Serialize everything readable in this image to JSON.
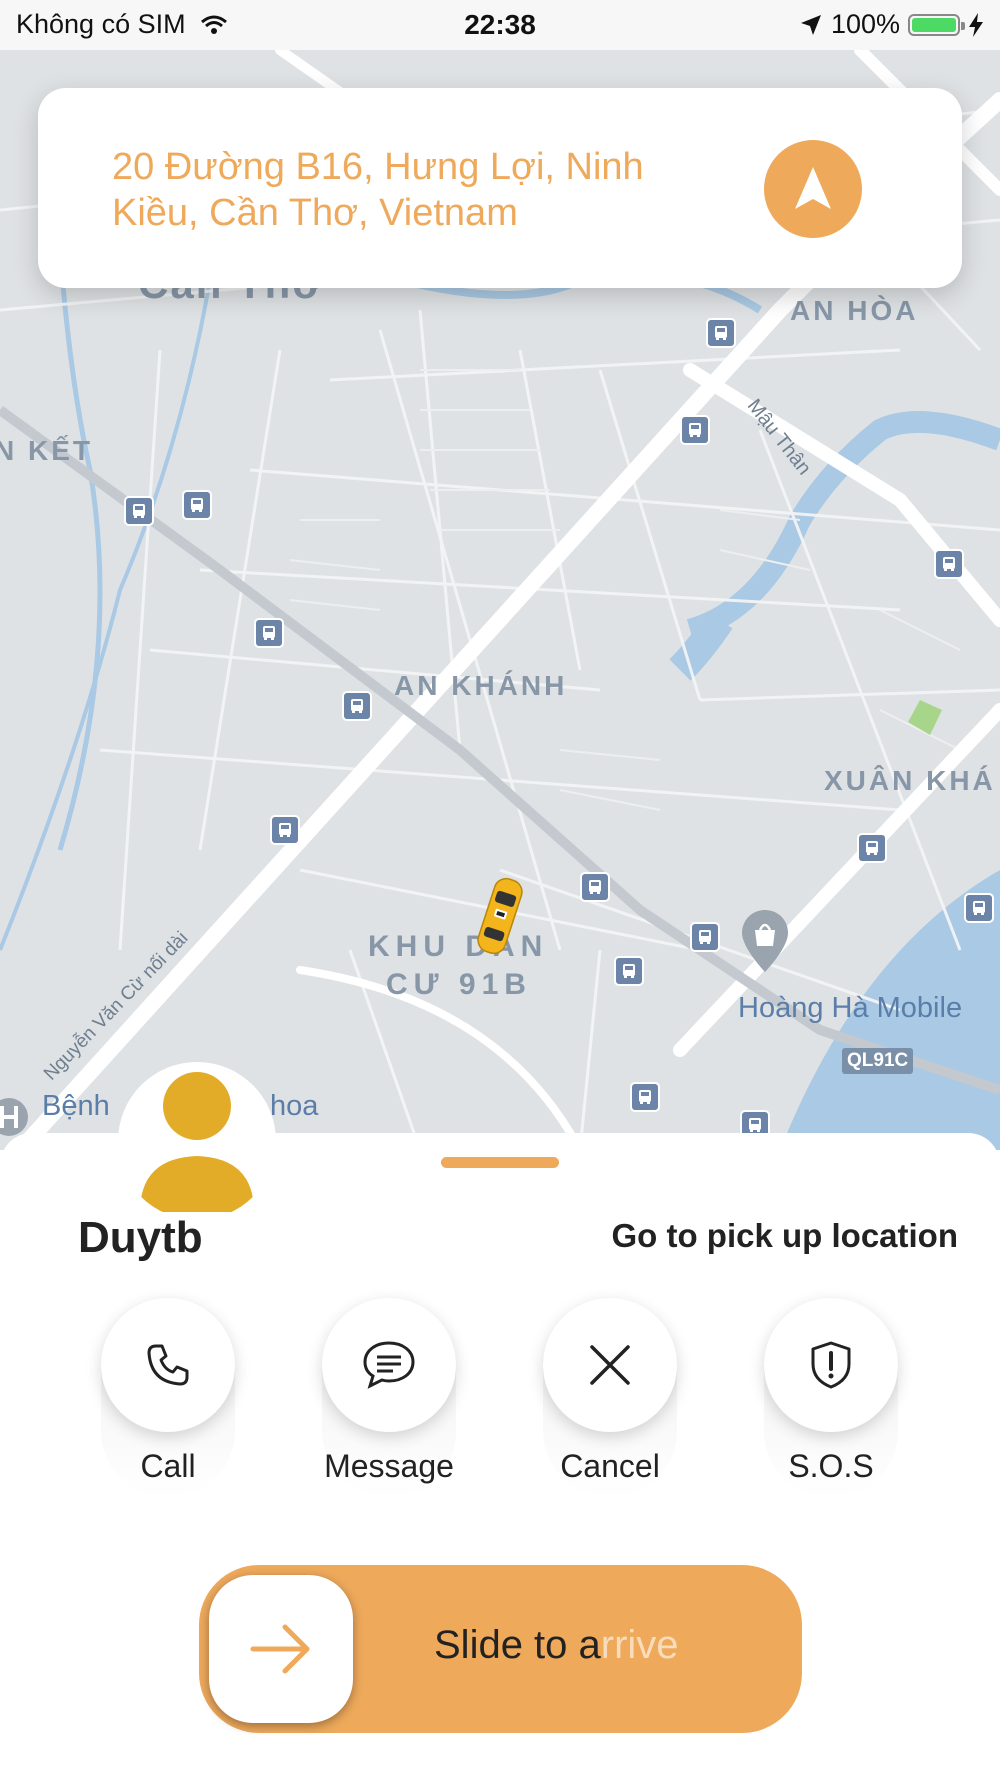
{
  "status_bar": {
    "carrier": "Không có SIM",
    "time": "22:38",
    "battery": "100%",
    "icons": [
      "wifi-icon",
      "location-arrow-icon",
      "battery-icon",
      "charging-bolt-icon"
    ]
  },
  "address": {
    "text_line1": "20 Đường B16, Hưng Lợi, Ninh",
    "text_line2": "Kiều, Cần Thơ, Vietnam",
    "nav_icon": "navigation-arrow-icon"
  },
  "map": {
    "labels": {
      "city": "Cần Thơ",
      "an_hoa": "AN HÒA",
      "ket": "N KẾT",
      "mau_than": "Mậu Thân",
      "an_khanh": "AN KHÁNH",
      "xuan_kha": "XUÂN KHÁ",
      "khu_dan_cu_1": "KHU DÂN",
      "khu_dan_cu_2": "CƯ 91B",
      "hoang_ha": "Hoàng Hà Mobile",
      "nguyen_van_cu": "Nguyễn Văn Cừ nối dài",
      "benh": "Bệnh",
      "hoa": "hoa",
      "ql91c": "QL91C"
    },
    "icons": [
      "bus-stop-icon",
      "taxi-car-icon",
      "shopping-pin-icon",
      "hospital-icon"
    ]
  },
  "driver": {
    "name": "Duytb",
    "status": "Go to pick up location",
    "avatar_icon": "person-avatar-icon"
  },
  "actions": [
    {
      "label": "Call",
      "icon": "phone-icon"
    },
    {
      "label": "Message",
      "icon": "chat-bubble-icon"
    },
    {
      "label": "Cancel",
      "icon": "close-icon"
    },
    {
      "label": "S.O.S",
      "icon": "shield-alert-icon"
    }
  ],
  "slider": {
    "text_main": "Slide to a",
    "text_fade": "rrive",
    "icon": "arrow-right-icon"
  },
  "colors": {
    "accent": "#eea95b",
    "avatar": "#e3ac28",
    "map_bg": "#dfe2e4",
    "road": "#ffffff",
    "water": "#a9c9e4",
    "map_label": "#8797a8",
    "bus_icon": "#6b84a8"
  }
}
